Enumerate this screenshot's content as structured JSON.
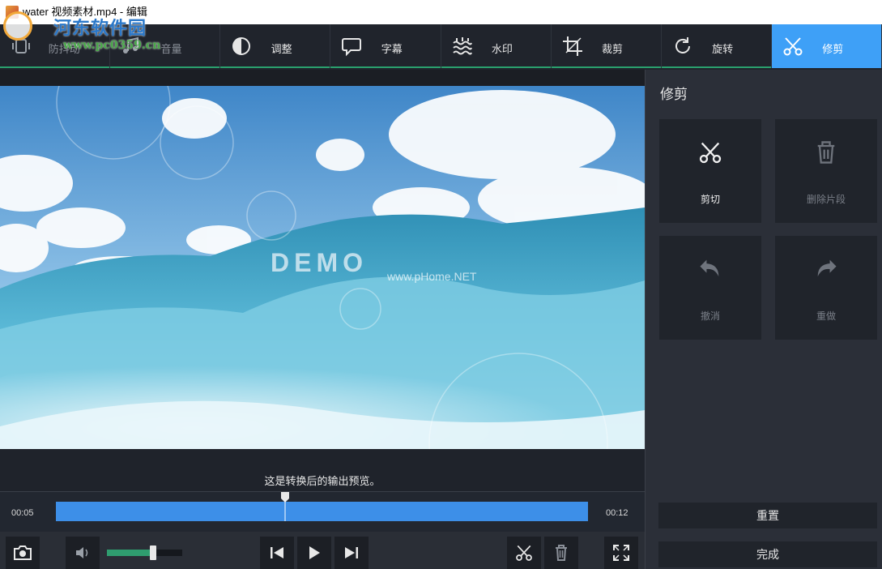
{
  "window": {
    "title": "water 视频素材.mp4 - 编辑"
  },
  "watermark": {
    "site": "河东软件园",
    "url": "www.pc0359.cn"
  },
  "toolbar": {
    "items": [
      {
        "label": "防抖动",
        "icon": "stabilize-icon"
      },
      {
        "label": "音量",
        "icon": "music-icon"
      },
      {
        "label": "调整",
        "icon": "contrast-icon"
      },
      {
        "label": "字幕",
        "icon": "speech-bubble-icon"
      },
      {
        "label": "水印",
        "icon": "watermark-icon"
      },
      {
        "label": "裁剪",
        "icon": "crop-icon"
      },
      {
        "label": "旋转",
        "icon": "rotate-icon"
      },
      {
        "label": "修剪",
        "icon": "scissors-icon"
      }
    ],
    "active": "修剪",
    "accent": "#3ea0f7"
  },
  "preview": {
    "overlay_demo": "DEMO",
    "overlay_url": "www.pHome.NET",
    "caption": "这是转换后的输出预览。"
  },
  "timeline": {
    "start": "00:05",
    "end": "00:12",
    "playhead_fraction": 0.43
  },
  "controls": {
    "volume_fraction": 0.61
  },
  "panel": {
    "title": "修剪",
    "buttons": [
      {
        "label": "剪切",
        "icon": "scissors-icon",
        "enabled": true
      },
      {
        "label": "删除片段",
        "icon": "trash-icon",
        "enabled": false
      },
      {
        "label": "撤消",
        "icon": "undo-icon",
        "enabled": false
      },
      {
        "label": "重做",
        "icon": "redo-icon",
        "enabled": false
      }
    ],
    "reset_label": "重置",
    "done_label": "完成"
  }
}
